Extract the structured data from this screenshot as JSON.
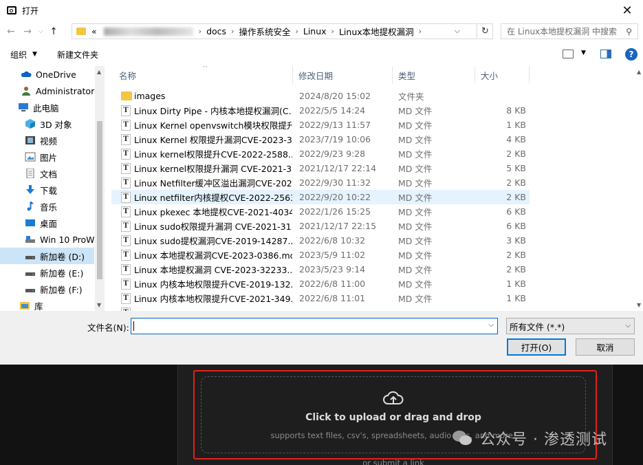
{
  "window": {
    "title": "打开",
    "close_symbol": "✕"
  },
  "address": {
    "crumbs": [
      "«",
      "docs",
      "操作系统安全",
      "Linux",
      "Linux本地提权漏洞"
    ],
    "search_placeholder": "在 Linux本地提权漏洞 中搜索"
  },
  "toolbar": {
    "organize": "组织",
    "new_folder": "新建文件夹"
  },
  "nav": {
    "items": [
      {
        "label": "OneDrive",
        "icon": "cloud-icon"
      },
      {
        "label": "Administrator",
        "icon": "user-icon"
      },
      {
        "label": "此电脑",
        "icon": "computer-icon"
      },
      {
        "label": "3D 对象",
        "icon": "cube-icon"
      },
      {
        "label": "视频",
        "icon": "video-icon"
      },
      {
        "label": "图片",
        "icon": "image-icon"
      },
      {
        "label": "文档",
        "icon": "document-icon"
      },
      {
        "label": "下载",
        "icon": "download-icon"
      },
      {
        "label": "音乐",
        "icon": "music-icon"
      },
      {
        "label": "桌面",
        "icon": "desktop-icon"
      },
      {
        "label": "Win 10 ProW",
        "icon": "drive-icon"
      },
      {
        "label": "新加卷 (D:)",
        "icon": "drive-icon"
      },
      {
        "label": "新加卷 (E:)",
        "icon": "drive-icon"
      },
      {
        "label": "新加卷 (F:)",
        "icon": "drive-icon"
      },
      {
        "label": "库",
        "icon": "library-icon"
      }
    ]
  },
  "columns": {
    "name": "名称",
    "date": "修改日期",
    "type": "类型",
    "size": "大小"
  },
  "files": [
    {
      "name": "images",
      "date": "2024/8/20 15:02",
      "type": "文件夹",
      "size": "",
      "folder": true
    },
    {
      "name": "Linux Dirty Pipe - 内核本地提权漏洞(C...",
      "date": "2022/5/5 14:24",
      "type": "MD 文件",
      "size": "8 KB"
    },
    {
      "name": "Linux Kernel openvswitch模块权限提升...",
      "date": "2022/9/13 11:57",
      "type": "MD 文件",
      "size": "1 KB"
    },
    {
      "name": "Linux Kernel 权限提升漏洞CVE-2023-3...",
      "date": "2023/7/19 10:06",
      "type": "MD 文件",
      "size": "4 KB"
    },
    {
      "name": "Linux kernel权限提升CVE-2022-2588....",
      "date": "2022/9/23 9:28",
      "type": "MD 文件",
      "size": "2 KB"
    },
    {
      "name": "Linux kernel权限提升漏洞 CVE-2021-3...",
      "date": "2021/12/17 22:14",
      "type": "MD 文件",
      "size": "5 KB"
    },
    {
      "name": "Linux Netfilter缓冲区溢出漏洞CVE-202...",
      "date": "2022/9/30 11:32",
      "type": "MD 文件",
      "size": "2 KB"
    },
    {
      "name": "Linux netfilter内核提权CVE-2022-2563...",
      "date": "2022/9/20 10:22",
      "type": "MD 文件",
      "size": "2 KB"
    },
    {
      "name": "Linux pkexec 本地提权CVE-2021-4034....",
      "date": "2022/1/26 15:25",
      "type": "MD 文件",
      "size": "6 KB"
    },
    {
      "name": "Linux sudo权限提升漏洞 CVE-2021-31...",
      "date": "2021/12/17 22:15",
      "type": "MD 文件",
      "size": "6 KB"
    },
    {
      "name": "Linux sudo提权漏洞CVE-2019-14287....",
      "date": "2022/6/8 10:32",
      "type": "MD 文件",
      "size": "3 KB"
    },
    {
      "name": "Linux 本地提权漏洞CVE-2023-0386.md",
      "date": "2023/5/9 11:02",
      "type": "MD 文件",
      "size": "2 KB"
    },
    {
      "name": "Linux 本地提权漏洞 CVE-2023-32233....",
      "date": "2023/5/23 9:14",
      "type": "MD 文件",
      "size": "2 KB"
    },
    {
      "name": "Linux 内核本地权限提升CVE-2019-132...",
      "date": "2022/6/8 11:00",
      "type": "MD 文件",
      "size": "1 KB"
    },
    {
      "name": "Linux 内核本地权限提升CVE-2021-349...",
      "date": "2022/6/8 11:01",
      "type": "MD 文件",
      "size": "1 KB"
    }
  ],
  "bottom": {
    "filename_label": "文件名(N):",
    "filename_value": "",
    "filter_value": "所有文件 (*.*)",
    "open_label": "打开(O)",
    "cancel_label": "取消"
  },
  "upload": {
    "title": "Click to upload or drag and drop",
    "subtitle": "supports text files, csv's, spreadsheets, audio files, and more!",
    "link": "or submit a link"
  },
  "watermark": {
    "text": "公众号 · 渗透测试"
  },
  "colors": {
    "accent": "#0078d7",
    "highlight_box": "#e2231a",
    "dark_bg": "#121212"
  }
}
